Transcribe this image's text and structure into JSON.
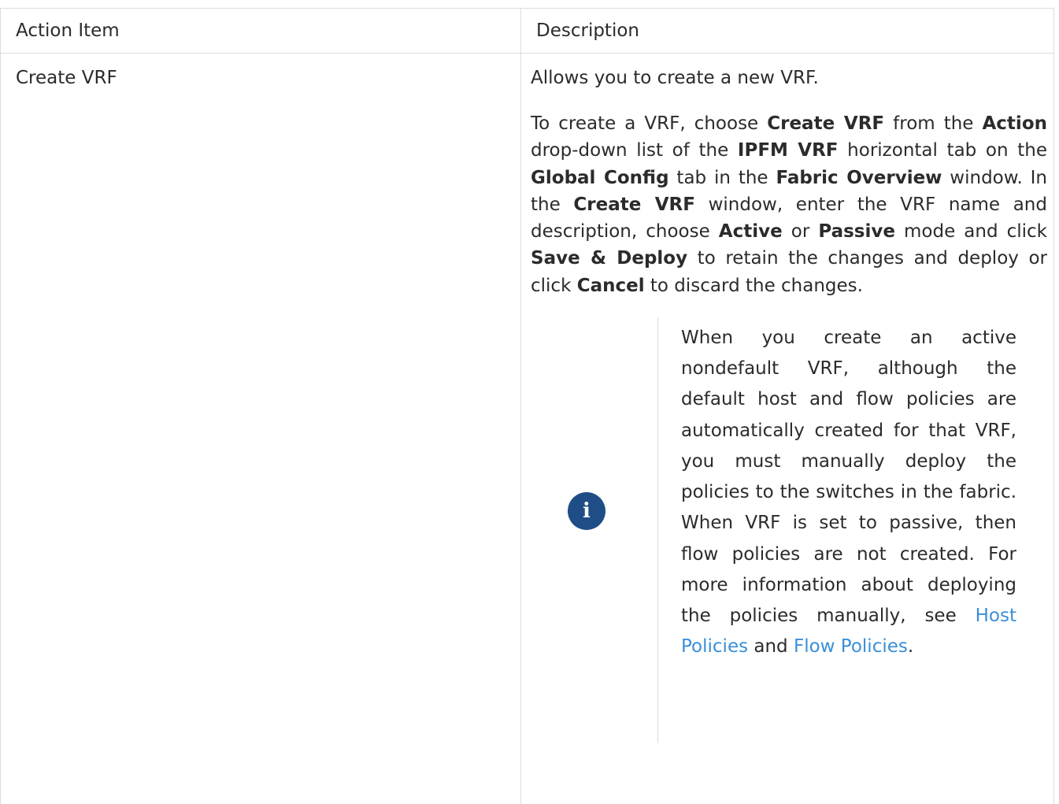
{
  "table": {
    "headers": {
      "action_item": "Action Item",
      "description": "Description"
    },
    "rows": [
      {
        "action": "Create VRF",
        "summary": "Allows you to create a new VRF.",
        "steps": [
          "To create a VRF, choose ",
          "Create VRF",
          " from the ",
          "Action",
          " drop-down list of the ",
          "IPFM VRF",
          " horizontal tab on the ",
          "Global Config",
          " tab in the ",
          "Fabric Overview",
          " window. In the ",
          "Create VRF",
          " window, enter the VRF name and description, choose ",
          "Active",
          " or ",
          "Passive",
          " mode and click ",
          "Save & Deploy",
          " to retain the changes and deploy or click ",
          "Cancel",
          " to discard the changes."
        ],
        "note": {
          "icon": "info-icon",
          "text_before": "When you create an active nondefault VRF, although the default host and flow policies are automatically created for that VRF, you must manually deploy the policies to the switches in the fabric. When VRF is set to passive, then flow policies are not created. For more information about deploying the policies manually, see ",
          "link1": "Host Policies",
          "text_between": " and ",
          "link2": "Flow Policies",
          "text_after": "."
        }
      }
    ]
  },
  "colors": {
    "border": "#dcdcdc",
    "link": "#3a8fd8",
    "info_icon_bg": "#1f4e86"
  }
}
